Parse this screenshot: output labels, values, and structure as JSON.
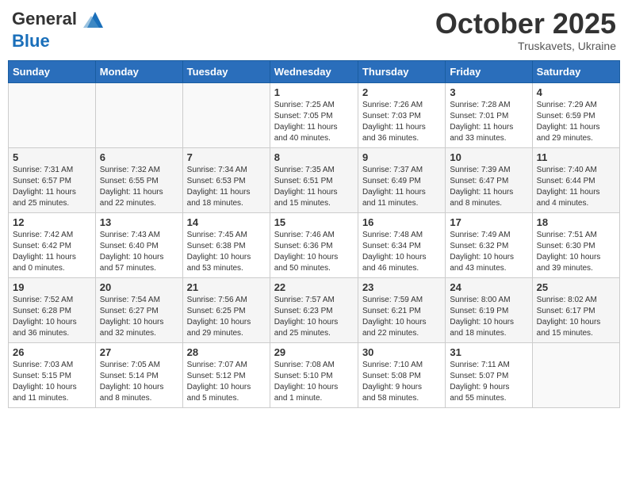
{
  "header": {
    "logo_line1": "General",
    "logo_line2": "Blue",
    "month": "October 2025",
    "location": "Truskavets, Ukraine"
  },
  "weekdays": [
    "Sunday",
    "Monday",
    "Tuesday",
    "Wednesday",
    "Thursday",
    "Friday",
    "Saturday"
  ],
  "weeks": [
    [
      {
        "day": "",
        "info": ""
      },
      {
        "day": "",
        "info": ""
      },
      {
        "day": "",
        "info": ""
      },
      {
        "day": "1",
        "info": "Sunrise: 7:25 AM\nSunset: 7:05 PM\nDaylight: 11 hours\nand 40 minutes."
      },
      {
        "day": "2",
        "info": "Sunrise: 7:26 AM\nSunset: 7:03 PM\nDaylight: 11 hours\nand 36 minutes."
      },
      {
        "day": "3",
        "info": "Sunrise: 7:28 AM\nSunset: 7:01 PM\nDaylight: 11 hours\nand 33 minutes."
      },
      {
        "day": "4",
        "info": "Sunrise: 7:29 AM\nSunset: 6:59 PM\nDaylight: 11 hours\nand 29 minutes."
      }
    ],
    [
      {
        "day": "5",
        "info": "Sunrise: 7:31 AM\nSunset: 6:57 PM\nDaylight: 11 hours\nand 25 minutes."
      },
      {
        "day": "6",
        "info": "Sunrise: 7:32 AM\nSunset: 6:55 PM\nDaylight: 11 hours\nand 22 minutes."
      },
      {
        "day": "7",
        "info": "Sunrise: 7:34 AM\nSunset: 6:53 PM\nDaylight: 11 hours\nand 18 minutes."
      },
      {
        "day": "8",
        "info": "Sunrise: 7:35 AM\nSunset: 6:51 PM\nDaylight: 11 hours\nand 15 minutes."
      },
      {
        "day": "9",
        "info": "Sunrise: 7:37 AM\nSunset: 6:49 PM\nDaylight: 11 hours\nand 11 minutes."
      },
      {
        "day": "10",
        "info": "Sunrise: 7:39 AM\nSunset: 6:47 PM\nDaylight: 11 hours\nand 8 minutes."
      },
      {
        "day": "11",
        "info": "Sunrise: 7:40 AM\nSunset: 6:44 PM\nDaylight: 11 hours\nand 4 minutes."
      }
    ],
    [
      {
        "day": "12",
        "info": "Sunrise: 7:42 AM\nSunset: 6:42 PM\nDaylight: 11 hours\nand 0 minutes."
      },
      {
        "day": "13",
        "info": "Sunrise: 7:43 AM\nSunset: 6:40 PM\nDaylight: 10 hours\nand 57 minutes."
      },
      {
        "day": "14",
        "info": "Sunrise: 7:45 AM\nSunset: 6:38 PM\nDaylight: 10 hours\nand 53 minutes."
      },
      {
        "day": "15",
        "info": "Sunrise: 7:46 AM\nSunset: 6:36 PM\nDaylight: 10 hours\nand 50 minutes."
      },
      {
        "day": "16",
        "info": "Sunrise: 7:48 AM\nSunset: 6:34 PM\nDaylight: 10 hours\nand 46 minutes."
      },
      {
        "day": "17",
        "info": "Sunrise: 7:49 AM\nSunset: 6:32 PM\nDaylight: 10 hours\nand 43 minutes."
      },
      {
        "day": "18",
        "info": "Sunrise: 7:51 AM\nSunset: 6:30 PM\nDaylight: 10 hours\nand 39 minutes."
      }
    ],
    [
      {
        "day": "19",
        "info": "Sunrise: 7:52 AM\nSunset: 6:28 PM\nDaylight: 10 hours\nand 36 minutes."
      },
      {
        "day": "20",
        "info": "Sunrise: 7:54 AM\nSunset: 6:27 PM\nDaylight: 10 hours\nand 32 minutes."
      },
      {
        "day": "21",
        "info": "Sunrise: 7:56 AM\nSunset: 6:25 PM\nDaylight: 10 hours\nand 29 minutes."
      },
      {
        "day": "22",
        "info": "Sunrise: 7:57 AM\nSunset: 6:23 PM\nDaylight: 10 hours\nand 25 minutes."
      },
      {
        "day": "23",
        "info": "Sunrise: 7:59 AM\nSunset: 6:21 PM\nDaylight: 10 hours\nand 22 minutes."
      },
      {
        "day": "24",
        "info": "Sunrise: 8:00 AM\nSunset: 6:19 PM\nDaylight: 10 hours\nand 18 minutes."
      },
      {
        "day": "25",
        "info": "Sunrise: 8:02 AM\nSunset: 6:17 PM\nDaylight: 10 hours\nand 15 minutes."
      }
    ],
    [
      {
        "day": "26",
        "info": "Sunrise: 7:03 AM\nSunset: 5:15 PM\nDaylight: 10 hours\nand 11 minutes."
      },
      {
        "day": "27",
        "info": "Sunrise: 7:05 AM\nSunset: 5:14 PM\nDaylight: 10 hours\nand 8 minutes."
      },
      {
        "day": "28",
        "info": "Sunrise: 7:07 AM\nSunset: 5:12 PM\nDaylight: 10 hours\nand 5 minutes."
      },
      {
        "day": "29",
        "info": "Sunrise: 7:08 AM\nSunset: 5:10 PM\nDaylight: 10 hours\nand 1 minute."
      },
      {
        "day": "30",
        "info": "Sunrise: 7:10 AM\nSunset: 5:08 PM\nDaylight: 9 hours\nand 58 minutes."
      },
      {
        "day": "31",
        "info": "Sunrise: 7:11 AM\nSunset: 5:07 PM\nDaylight: 9 hours\nand 55 minutes."
      },
      {
        "day": "",
        "info": ""
      }
    ]
  ]
}
